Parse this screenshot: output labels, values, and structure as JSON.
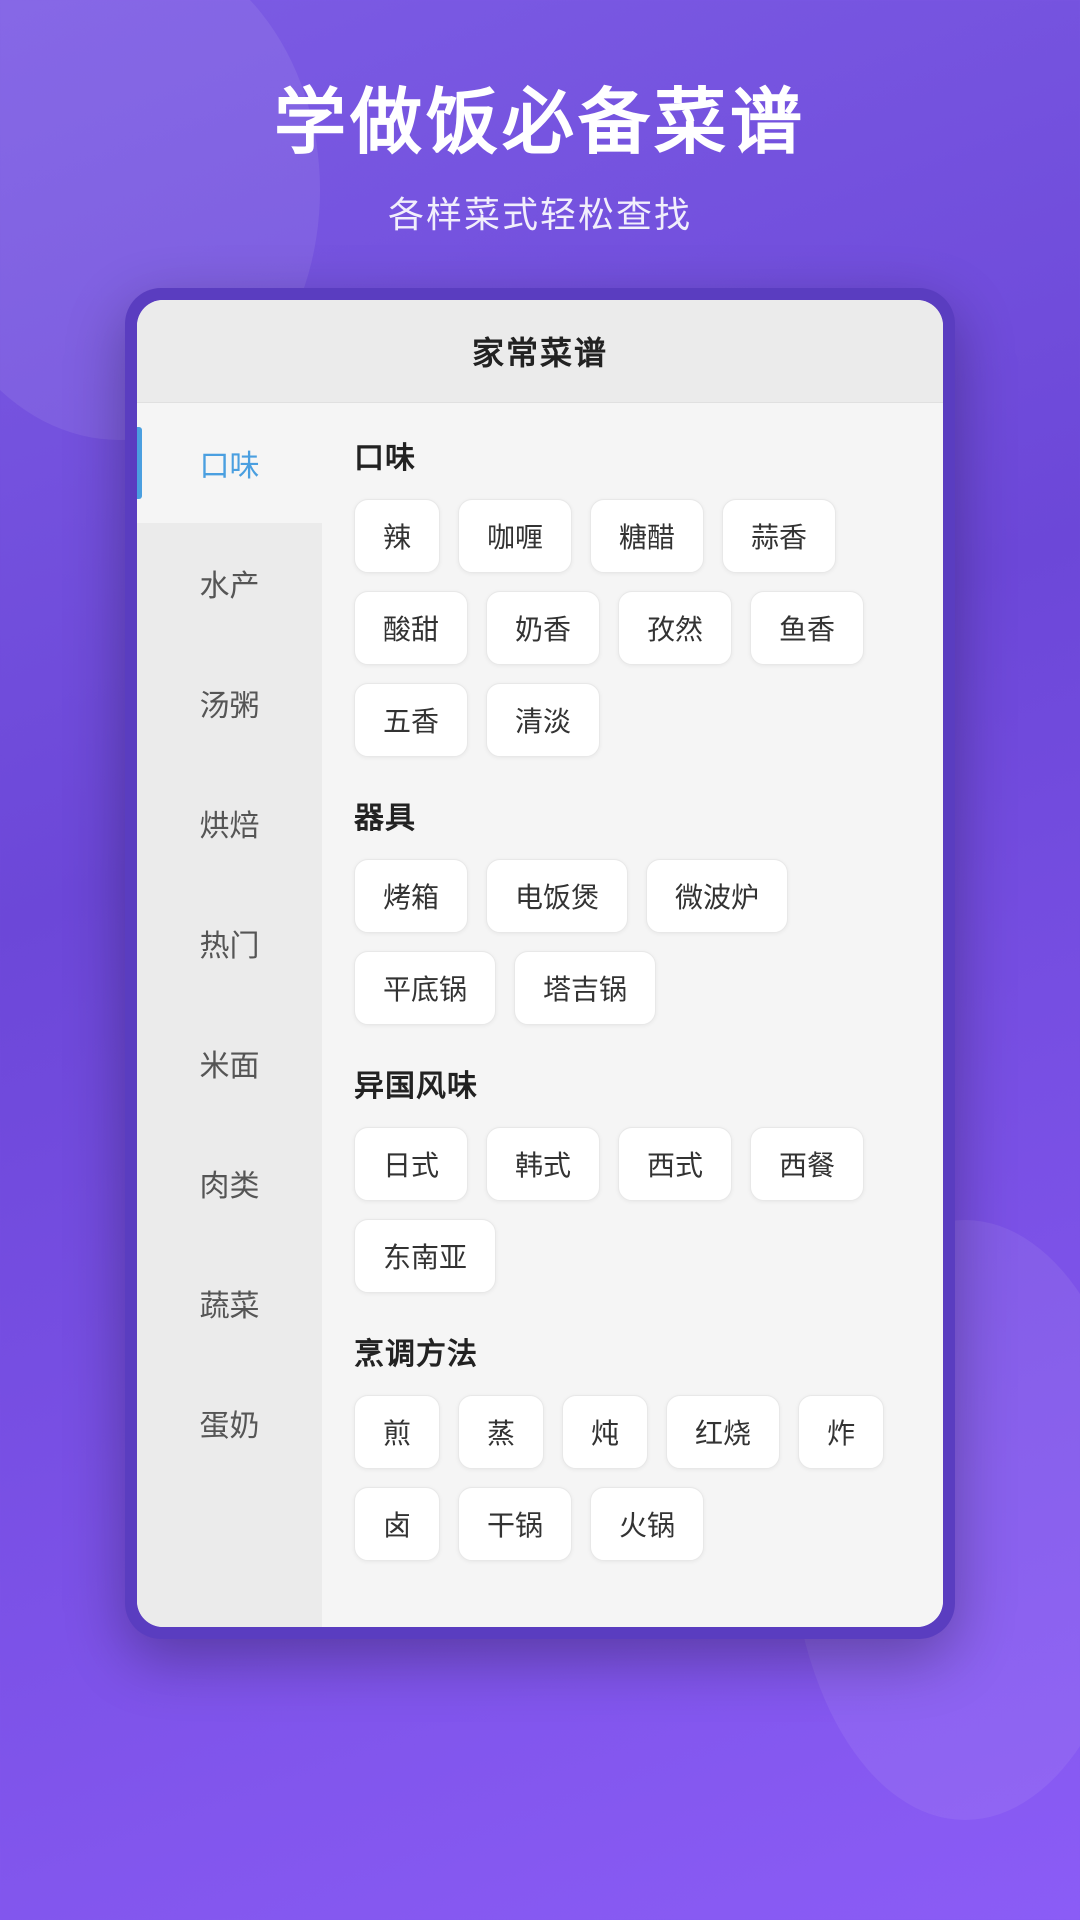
{
  "hero": {
    "title": "学做饭必备菜谱",
    "subtitle": "各样菜式轻松查找"
  },
  "card": {
    "header_title": "家常菜谱"
  },
  "sidebar": {
    "items": [
      {
        "id": "kouwei",
        "label": "口味",
        "active": true
      },
      {
        "id": "shuichan",
        "label": "水产",
        "active": false
      },
      {
        "id": "tangzhou",
        "label": "汤粥",
        "active": false
      },
      {
        "id": "hongbei",
        "label": "烘焙",
        "active": false
      },
      {
        "id": "remen",
        "label": "热门",
        "active": false
      },
      {
        "id": "mimian",
        "label": "米面",
        "active": false
      },
      {
        "id": "roulei",
        "label": "肉类",
        "active": false
      },
      {
        "id": "shucai",
        "label": "蔬菜",
        "active": false
      },
      {
        "id": "dannai",
        "label": "蛋奶",
        "active": false
      }
    ]
  },
  "sections": [
    {
      "id": "kouwei",
      "title": "口味",
      "tags": [
        "辣",
        "咖喱",
        "糖醋",
        "蒜香",
        "酸甜",
        "奶香",
        "孜然",
        "鱼香",
        "五香",
        "清淡"
      ]
    },
    {
      "id": "qiju",
      "title": "器具",
      "tags": [
        "烤箱",
        "电饭煲",
        "微波炉",
        "平底锅",
        "塔吉锅"
      ]
    },
    {
      "id": "yiguo",
      "title": "异国风味",
      "tags": [
        "日式",
        "韩式",
        "西式",
        "西餐",
        "东南亚"
      ]
    },
    {
      "id": "pengtiao",
      "title": "烹调方法",
      "tags": [
        "煎",
        "蒸",
        "炖",
        "红烧",
        "炸",
        "卤",
        "干锅",
        "火锅"
      ]
    }
  ]
}
